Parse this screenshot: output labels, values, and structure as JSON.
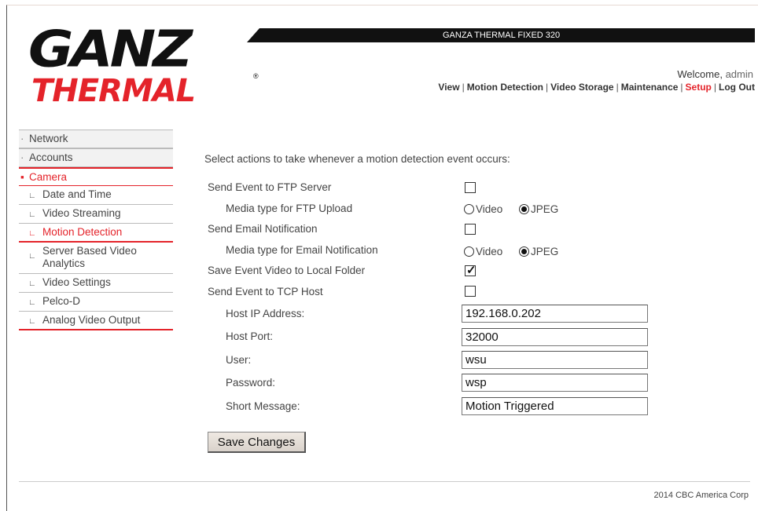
{
  "logo": {
    "line1": "GANZ",
    "line2": "THERMAL",
    "reg": "®"
  },
  "header": {
    "title": "GANZA THERMAL FIXED 320",
    "welcome": "Welcome,",
    "user": "admin"
  },
  "topnav": [
    {
      "label": "View",
      "active": false
    },
    {
      "label": "Motion Detection",
      "active": false
    },
    {
      "label": "Video Storage",
      "active": false
    },
    {
      "label": "Maintenance",
      "active": false
    },
    {
      "label": "Setup",
      "active": true
    },
    {
      "label": "Log Out",
      "active": false
    }
  ],
  "sidebar": {
    "network": "Network",
    "accounts": "Accounts",
    "camera": "Camera",
    "items": [
      {
        "label": "Date and Time"
      },
      {
        "label": "Video Streaming"
      },
      {
        "label": "Motion Detection",
        "active": true
      },
      {
        "label": "Server Based Video Analytics"
      },
      {
        "label": "Video Settings"
      },
      {
        "label": "Pelco-D"
      },
      {
        "label": "Analog Video Output"
      }
    ]
  },
  "form": {
    "intro": "Select actions to take whenever a motion detection event occurs:",
    "ftp_label": "Send Event to FTP Server",
    "ftp_checked": false,
    "ftp_media_label": "Media type for FTP Upload",
    "email_label": "Send Email Notification",
    "email_checked": false,
    "email_media_label": "Media type for Email Notification",
    "local_label": "Save Event Video to Local Folder",
    "local_checked": true,
    "tcp_label": "Send Event to TCP Host",
    "tcp_checked": false,
    "media_options": {
      "video": "Video",
      "jpeg": "JPEG",
      "selected": "JPEG"
    },
    "host_ip_label": "Host IP Address:",
    "host_ip": "192.168.0.202",
    "host_port_label": "Host Port:",
    "host_port": "32000",
    "user_label": "User:",
    "user": "wsu",
    "password_label": "Password:",
    "password": "wsp",
    "message_label": "Short Message:",
    "message": "Motion Triggered",
    "save_label": "Save Changes"
  },
  "footer": {
    "copyright": "2014 CBC America Corp"
  },
  "colors": {
    "accent": "#e4232a",
    "titlebar": "#111111"
  }
}
